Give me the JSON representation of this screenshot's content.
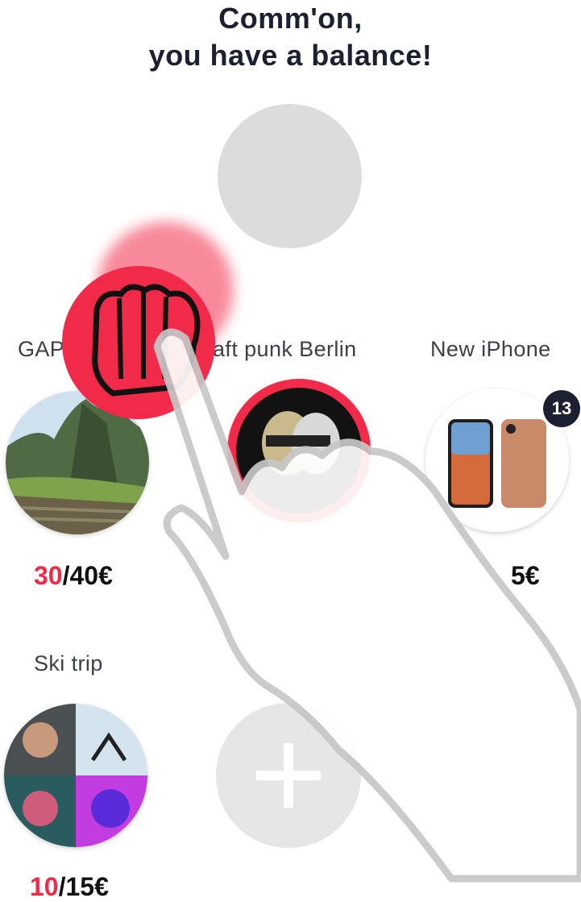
{
  "header": {
    "title_line1": "Comm'on,",
    "title_line2": "you have a balance!"
  },
  "goals": [
    {
      "name": "GAP",
      "current": "30",
      "sep": "/",
      "target": "40€",
      "image": "machu-picchu-photo"
    },
    {
      "name": "aft punk Berlin",
      "image": "daft-punk-helmet-photo"
    },
    {
      "name": "New iPhone",
      "amount_visible": "5€",
      "badge": "13",
      "image": "iphone-photo"
    },
    {
      "name": "Ski trip",
      "current": "10",
      "sep": "/",
      "target": "15€",
      "image": "friends-collage-photo"
    }
  ],
  "add_button": {
    "icon": "plus-icon"
  },
  "overlay": {
    "icons": [
      "fist-icon",
      "hand-pointer-icon"
    ]
  },
  "colors": {
    "accent": "#f12a4a",
    "dark": "#1c2030",
    "placeholder": "#dcdcdc"
  }
}
